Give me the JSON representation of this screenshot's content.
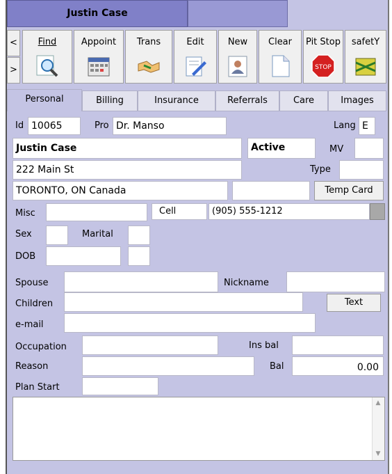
{
  "header": {
    "patient_name": "Justin Case"
  },
  "nav": {
    "prev": "<",
    "next": ">"
  },
  "toolbar": {
    "find": "Find",
    "appoint": "Appoint",
    "trans": "Trans",
    "edit": "Edit",
    "new": "New",
    "clear": "Clear",
    "pitstop": "Pit Stop",
    "safety": "safetY",
    "stop_text": "STOP"
  },
  "tabs": [
    "Personal",
    "Billing",
    "Insurance",
    "Referrals",
    "Care",
    "Images"
  ],
  "form": {
    "id_label": "Id",
    "id_value": "10065",
    "pro_label": "Pro",
    "pro_value": "Dr. Manso",
    "lang_label": "Lang",
    "lang_value": "E",
    "name_value": "Justin Case",
    "status_value": "Active",
    "mv_label": "MV",
    "mv_value": "",
    "address_value": "222 Main St",
    "type_label": "Type",
    "type_value": "",
    "city_value": "TORONTO, ON  Canada",
    "postal_value": "",
    "temp_card_button": "Temp Card",
    "misc_label": "Misc",
    "misc_value": "",
    "cell_label": "Cell",
    "cell_value": "(905) 555-1212",
    "sex_label": "Sex",
    "sex_value": "",
    "marital_label": "Marital",
    "marital_value": "",
    "dob_label": "DOB",
    "dob_value": "",
    "dob_extra": "",
    "spouse_label": "Spouse",
    "spouse_value": "",
    "nickname_label": "Nickname",
    "nickname_value": "",
    "children_label": "Children",
    "children_value": "",
    "text_button": "Text",
    "email_label": "e-mail",
    "email_value": "",
    "occupation_label": "Occupation",
    "occupation_value": "",
    "ins_bal_label": "Ins bal",
    "ins_bal_value": "",
    "reason_label": "Reason",
    "reason_value": "",
    "bal_label": "Bal",
    "bal_value": "0.00",
    "plan_start_label": "Plan Start",
    "plan_start_value": "",
    "notes_value": ""
  },
  "colors": {
    "background": "#c4c4e4",
    "title_tab": "#8080c8",
    "stop_red": "#d42020"
  }
}
